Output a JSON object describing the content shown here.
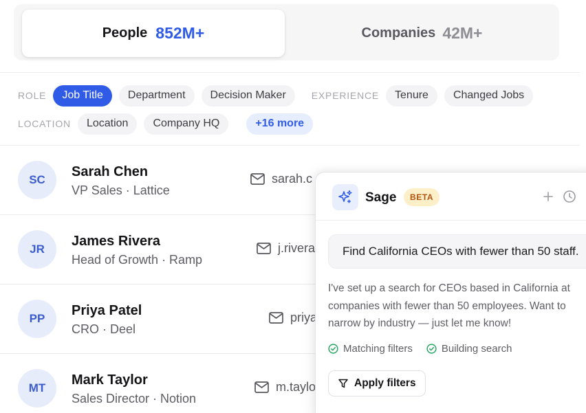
{
  "tabs": {
    "people": {
      "label": "People",
      "count": "852M+"
    },
    "companies": {
      "label": "Companies",
      "count": "42M+"
    }
  },
  "filters": {
    "role": {
      "label": "ROLE",
      "chips": [
        "Job Title",
        "Department",
        "Decision Maker"
      ],
      "active": "Job Title"
    },
    "experience": {
      "label": "EXPERIENCE",
      "chips": [
        "Tenure",
        "Changed Jobs"
      ]
    },
    "location": {
      "label": "LOCATION",
      "chips": [
        "Location",
        "Company HQ"
      ]
    },
    "more": "+16 more"
  },
  "contacts": [
    {
      "initials": "SC",
      "name": "Sarah Chen",
      "meta": "VP Sales · Lattice",
      "email": "sarah.c"
    },
    {
      "initials": "JR",
      "name": "James Rivera",
      "meta": "Head of Growth · Ramp",
      "email": "j.rivera"
    },
    {
      "initials": "PP",
      "name": "Priya Patel",
      "meta": "CRO · Deel",
      "email": "priya"
    },
    {
      "initials": "MT",
      "name": "Mark Taylor",
      "meta": "Sales Director · Notion",
      "email": "m.taylo"
    }
  ],
  "sage": {
    "title": "Sage",
    "badge": "BETA",
    "prompt": "Find California CEOs with fewer than 50 staff.",
    "reply": "I've set up a search for CEOs based in California at companies with fewer than 50 employees. Want to narrow by industry — just let me know!",
    "statuses": [
      "Matching filters",
      "Building search"
    ],
    "apply_label": "Apply filters"
  },
  "colors": {
    "accent": "#2f5be6",
    "success": "#22a45d",
    "beta_bg": "#fdf0c9",
    "beta_text": "#b5530e"
  }
}
